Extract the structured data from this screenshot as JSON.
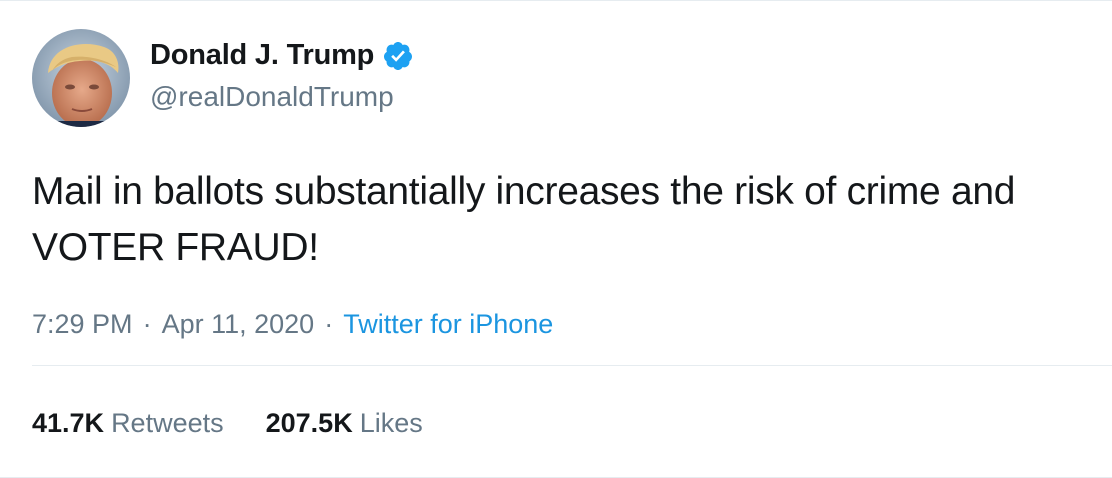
{
  "user": {
    "display_name": "Donald J. Trump",
    "handle": "@realDonaldTrump",
    "verified": true,
    "verified_icon": "verified-badge-icon"
  },
  "tweet": {
    "text": "Mail in ballots substantially increases the risk of crime and VOTER FRAUD!",
    "time": "7:29 PM",
    "separator": "·",
    "date": "Apr 11, 2020",
    "source": "Twitter for iPhone"
  },
  "stats": {
    "retweets_count": "41.7K",
    "retweets_label": "Retweets",
    "likes_count": "207.5K",
    "likes_label": "Likes"
  },
  "colors": {
    "text": "#14171a",
    "secondary": "#657786",
    "link": "#1b95e0",
    "verified": "#1da1f2",
    "divider": "#e6ecf0"
  }
}
